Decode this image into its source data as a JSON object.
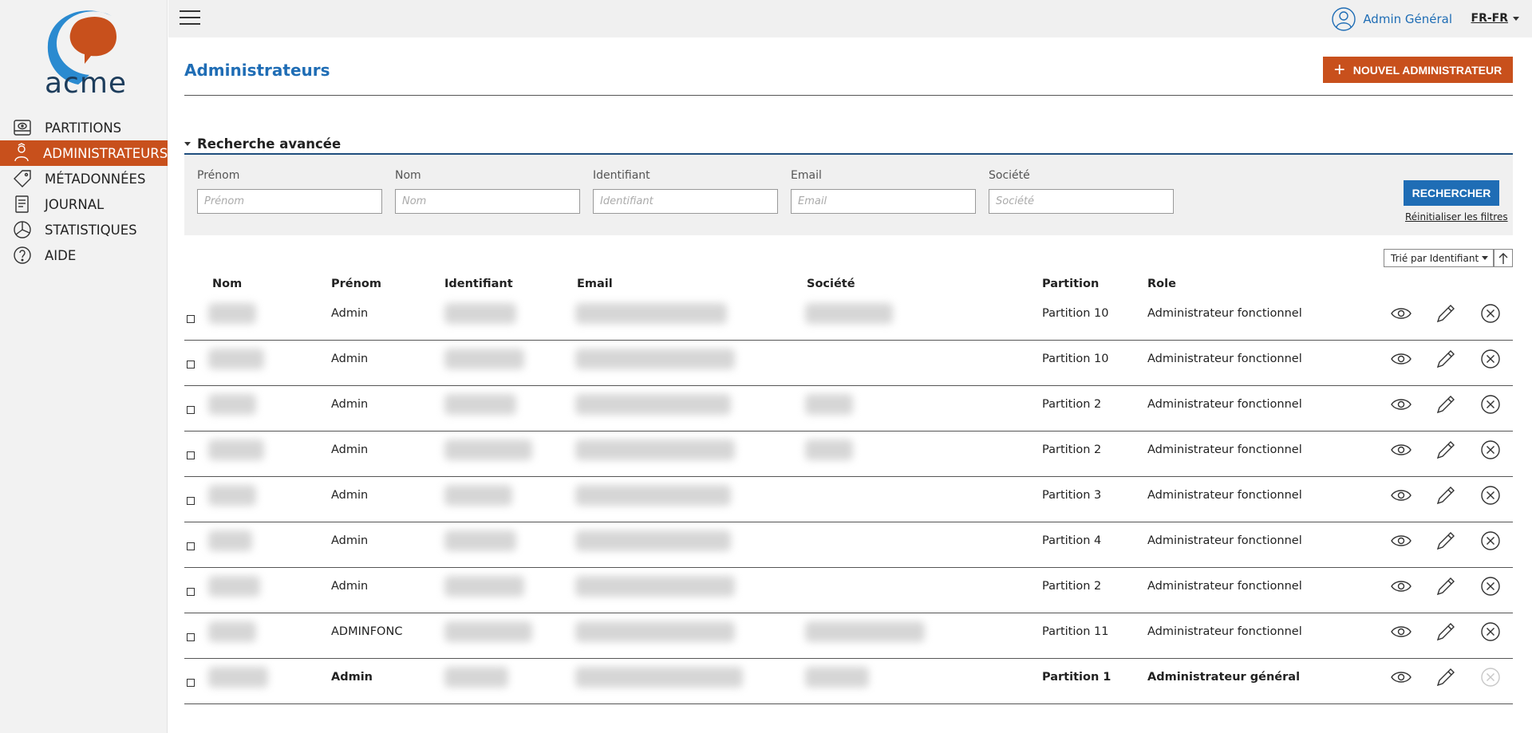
{
  "brand": {
    "logo_text": "acme",
    "accent": "#c8501c",
    "primary": "#1f6db5"
  },
  "sidebar": {
    "items": [
      {
        "label": "PARTITIONS",
        "icon": "drive-icon",
        "active": false
      },
      {
        "label": "ADMINISTRATEURS",
        "icon": "admin-user-icon",
        "active": true
      },
      {
        "label": "MÉTADONNÉES",
        "icon": "tag-icon",
        "active": false
      },
      {
        "label": "JOURNAL",
        "icon": "journal-icon",
        "active": false
      },
      {
        "label": "STATISTIQUES",
        "icon": "pie-chart-icon",
        "active": false
      },
      {
        "label": "AIDE",
        "icon": "help-icon",
        "active": false
      }
    ]
  },
  "header": {
    "user_name": "Admin Général",
    "language": "FR-FR"
  },
  "page": {
    "title": "Administrateurs",
    "new_button": "NOUVEL ADMINISTRATEUR"
  },
  "search": {
    "title": "Recherche avancée",
    "fields": [
      {
        "label": "Prénom",
        "placeholder": "Prénom"
      },
      {
        "label": "Nom",
        "placeholder": "Nom"
      },
      {
        "label": "Identifiant",
        "placeholder": "Identifiant"
      },
      {
        "label": "Email",
        "placeholder": "Email"
      },
      {
        "label": "Société",
        "placeholder": "Société"
      }
    ],
    "submit": "RECHERCHER",
    "reset": "Réinitialiser les filtres"
  },
  "sort": {
    "label": "Trié par Identifiant"
  },
  "table": {
    "columns": [
      "Nom",
      "Prénom",
      "Identifiant",
      "Email",
      "Société",
      "Partition",
      "Role"
    ],
    "rows": [
      {
        "prenom": "Admin",
        "partition": "Partition 10",
        "role": "Administrateur fonctionnel",
        "bold": false,
        "has_societe": true
      },
      {
        "prenom": "Admin",
        "partition": "Partition 10",
        "role": "Administrateur fonctionnel",
        "bold": false,
        "has_societe": false
      },
      {
        "prenom": "Admin",
        "partition": "Partition 2",
        "role": "Administrateur fonctionnel",
        "bold": false,
        "has_societe": true
      },
      {
        "prenom": "Admin",
        "partition": "Partition 2",
        "role": "Administrateur fonctionnel",
        "bold": false,
        "has_societe": true
      },
      {
        "prenom": "Admin",
        "partition": "Partition 3",
        "role": "Administrateur fonctionnel",
        "bold": false,
        "has_societe": false
      },
      {
        "prenom": "Admin",
        "partition": "Partition 4",
        "role": "Administrateur fonctionnel",
        "bold": false,
        "has_societe": false
      },
      {
        "prenom": "Admin",
        "partition": "Partition 2",
        "role": "Administrateur fonctionnel",
        "bold": false,
        "has_societe": false
      },
      {
        "prenom": "ADMINFONC",
        "partition": "Partition 11",
        "role": "Administrateur fonctionnel",
        "bold": false,
        "has_societe": true
      },
      {
        "prenom": "Admin",
        "partition": "Partition 1",
        "role": "Administrateur général",
        "bold": true,
        "has_societe": true,
        "delete_disabled": true
      }
    ]
  }
}
